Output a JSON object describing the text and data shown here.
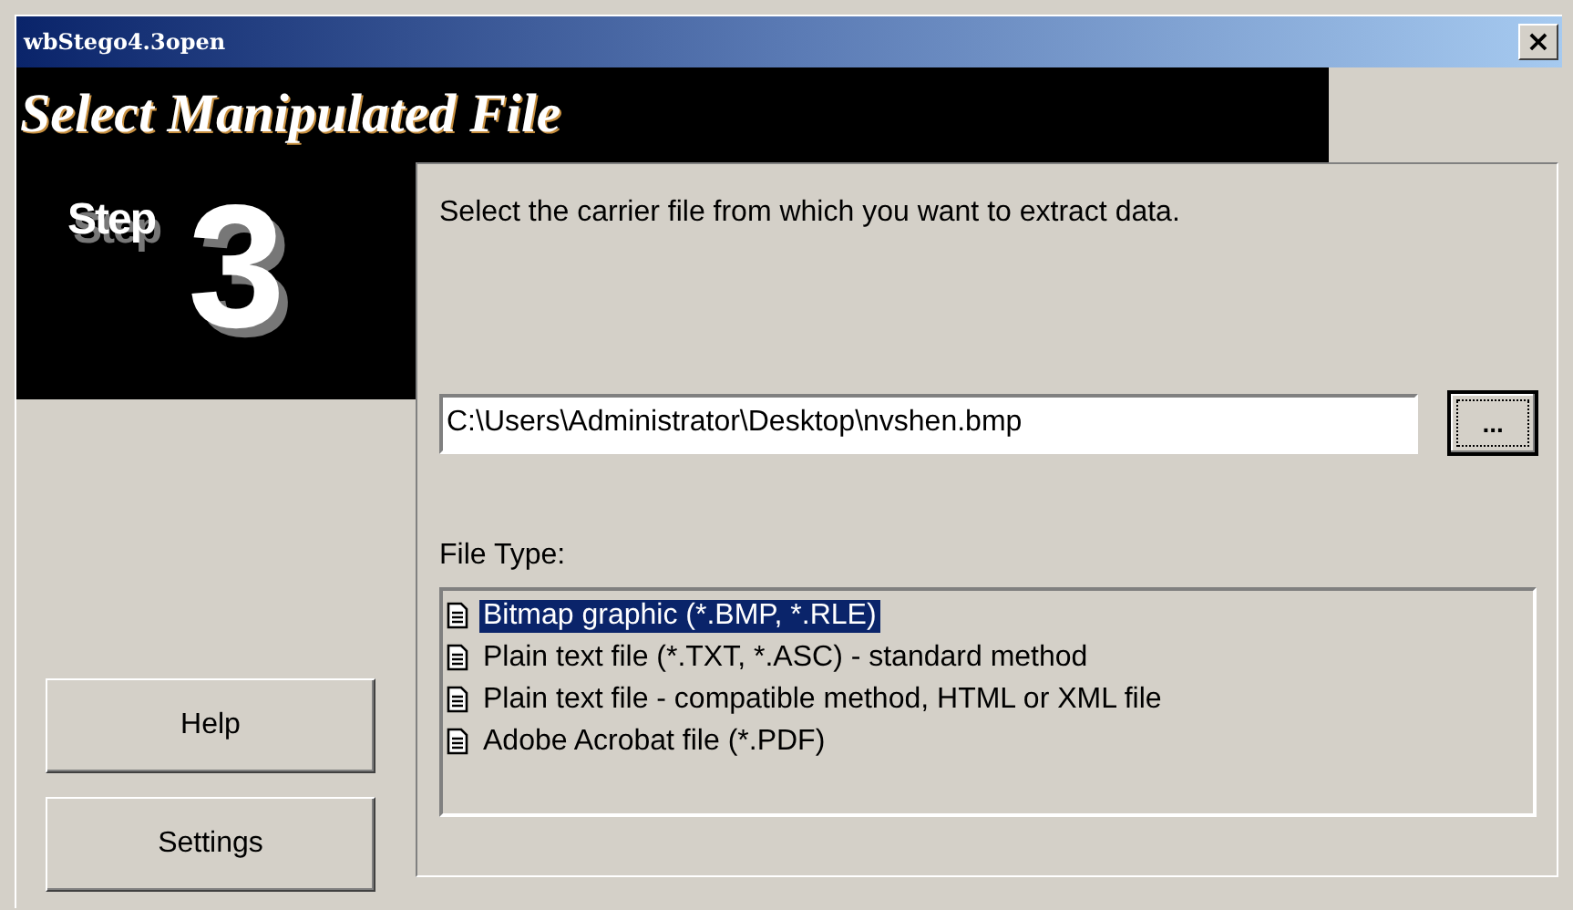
{
  "window": {
    "title": "wbStego4.3open",
    "close": "×"
  },
  "header": {
    "title": "Select Manipulated File"
  },
  "step": {
    "label": "Step",
    "number": "3"
  },
  "instruction": "Select the carrier file from which you want to extract data.",
  "file_field": {
    "value": "C:\\Users\\Administrator\\Desktop\\nvshen.bmp"
  },
  "browse_button": "...",
  "file_type": {
    "label": "File Type:",
    "items": [
      {
        "label": "Bitmap graphic (*.BMP, *.RLE)",
        "selected": true
      },
      {
        "label": "Plain text file (*.TXT, *.ASC) - standard method",
        "selected": false
      },
      {
        "label": "Plain text file - compatible method, HTML or XML file",
        "selected": false
      },
      {
        "label": "Adobe Acrobat file (*.PDF)",
        "selected": false
      }
    ]
  },
  "buttons": [
    "Help",
    "Settings"
  ]
}
